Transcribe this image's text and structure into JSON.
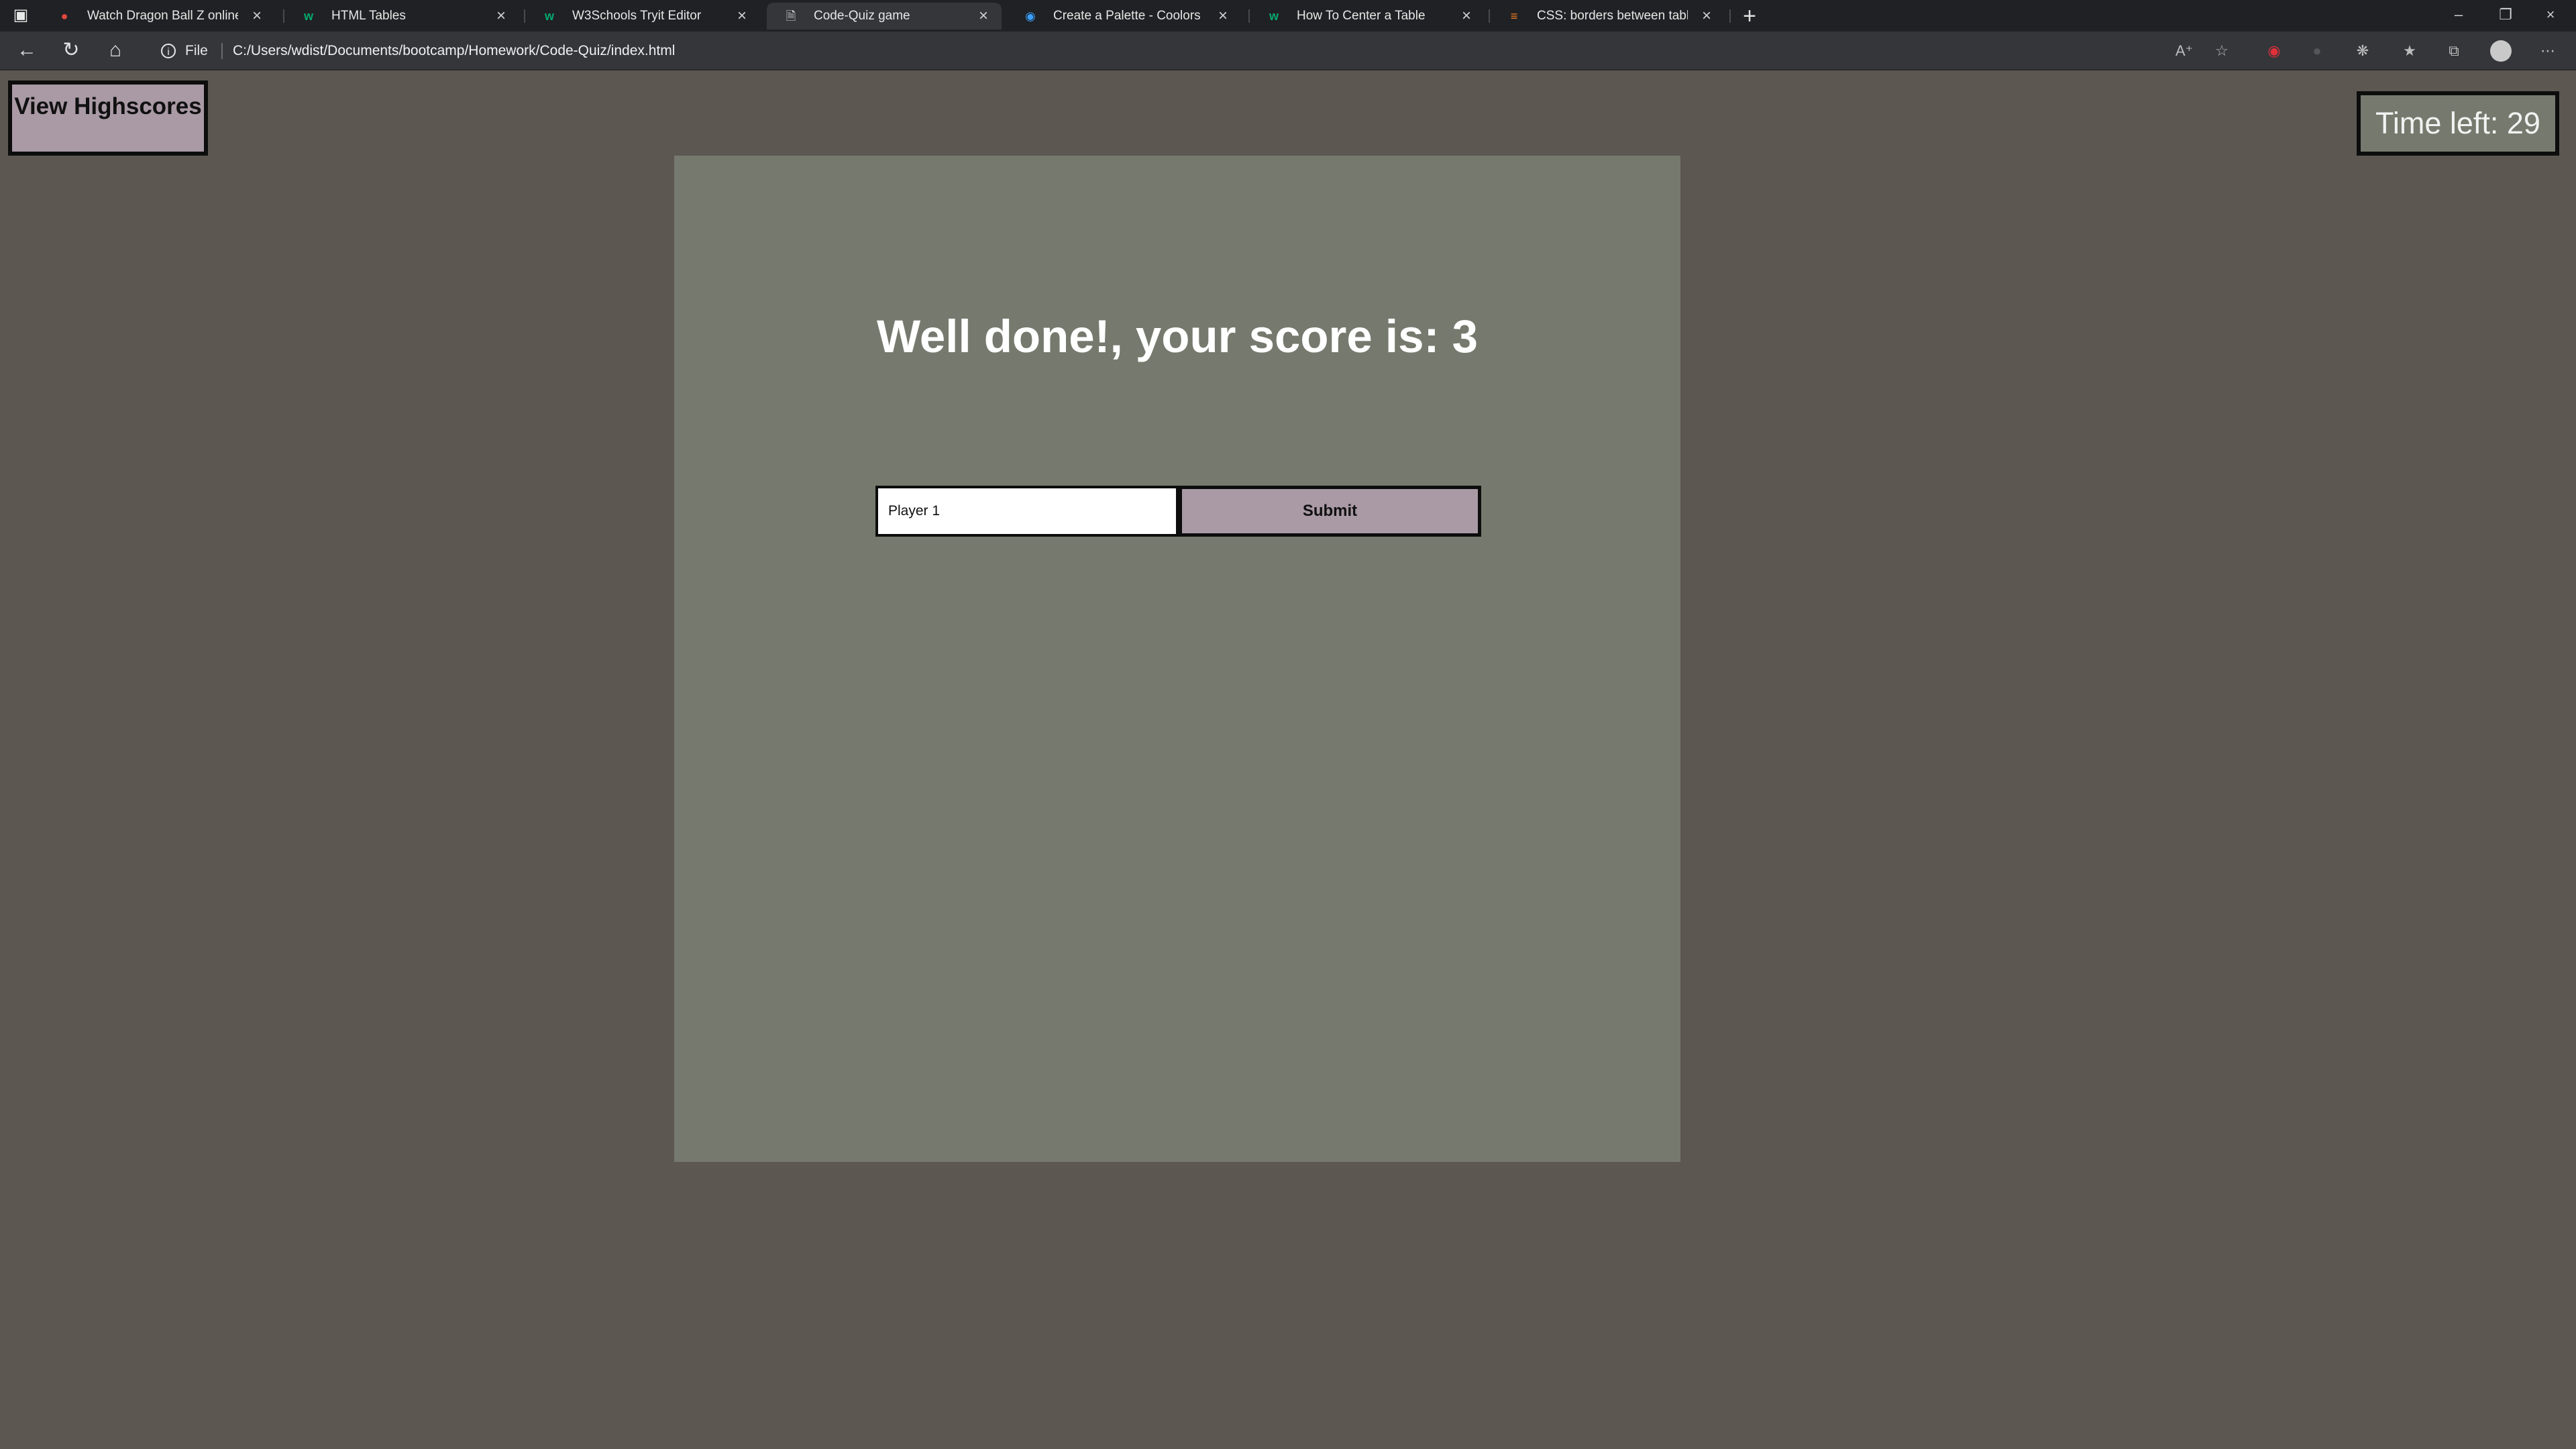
{
  "browser": {
    "tabs": [
      {
        "title": "Watch Dragon Ball Z online free",
        "favicon": "dragon-ball-favicon",
        "active": false
      },
      {
        "title": "HTML Tables",
        "favicon": "w3schools-favicon",
        "active": false
      },
      {
        "title": "W3Schools Tryit Editor",
        "favicon": "w3schools-favicon",
        "active": false
      },
      {
        "title": "Code-Quiz game",
        "favicon": "file-favicon",
        "active": true
      },
      {
        "title": "Create a Palette - Coolors",
        "favicon": "coolors-favicon",
        "active": false
      },
      {
        "title": "How To Center a Table",
        "favicon": "w3schools-favicon",
        "active": false
      },
      {
        "title": "CSS: borders between table colu",
        "favicon": "stackoverflow-favicon",
        "active": false
      }
    ],
    "address": {
      "scheme_label": "File",
      "url": "C:/Users/wdist/Documents/bootcamp/Homework/Code-Quiz/index.html"
    }
  },
  "page": {
    "highscores_button": "View Highscores",
    "timer_text": "Time left: 29",
    "result_heading": "Well done!, your score is: 3",
    "initials_input_value": "Player 1",
    "submit_label": "Submit"
  },
  "colors": {
    "page_background": "#5c5750",
    "card_background": "#767a6e",
    "button_background": "#a99aa5",
    "chrome_dark": "#202124",
    "chrome_toolbar": "#35363a"
  }
}
